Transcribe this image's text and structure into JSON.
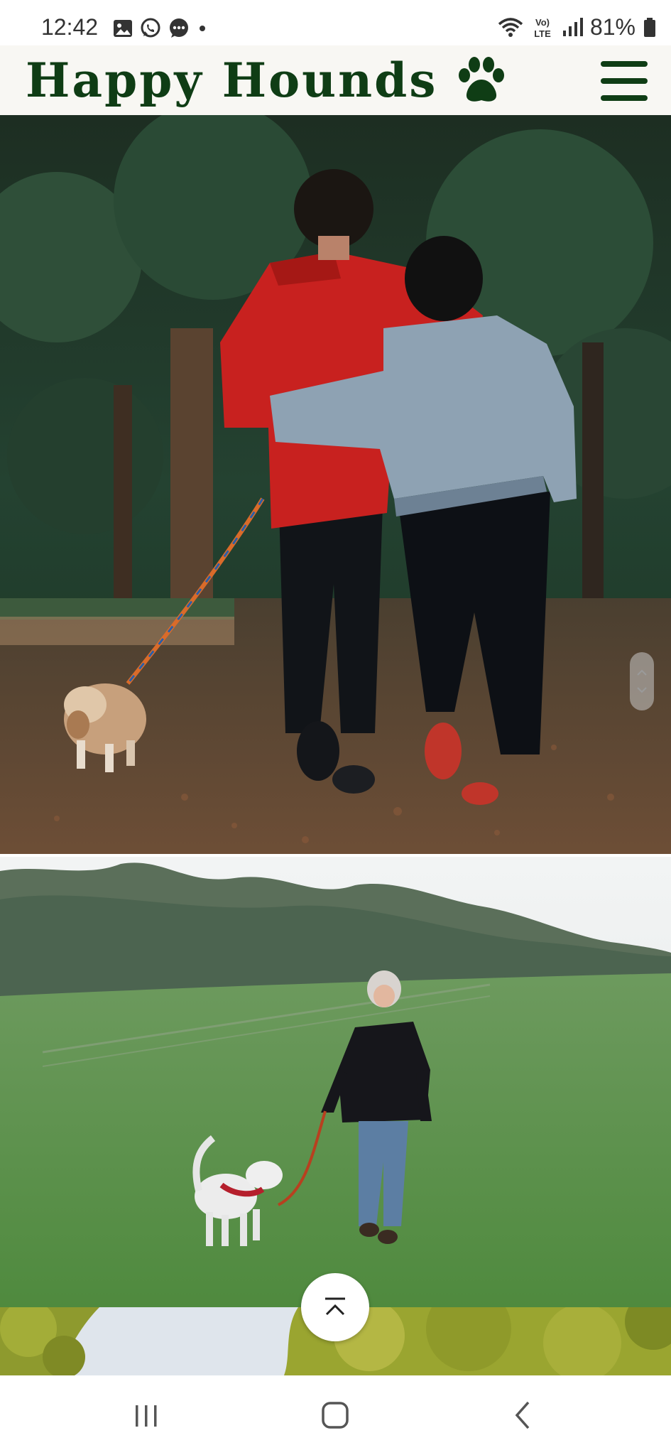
{
  "status_bar": {
    "time": "12:42",
    "left_icons": [
      "gallery-icon",
      "whatsapp-icon",
      "messages-icon",
      "notification-dot-icon"
    ],
    "right_icons": [
      "wifi-icon",
      "volte-icon",
      "signal-icon",
      "battery-icon"
    ],
    "network_label_top": "Vo)",
    "network_label_bottom": "LTE",
    "battery": "81%"
  },
  "header": {
    "title": "Happy Hounds",
    "logo_icon": "paw-icon",
    "menu_icon": "hamburger-menu-icon",
    "brand_color": "#0f3d15",
    "background": "#f8f7f3"
  },
  "photos": [
    {
      "subject": "couple-walking-dog-in-park"
    },
    {
      "subject": "woman-walking-dog-on-field"
    },
    {
      "subject": "trees-and-sky"
    }
  ],
  "controls": {
    "back_to_top_icon": "chevron-up-icon"
  },
  "nav_bar": {
    "items": [
      "recents-icon",
      "home-icon",
      "back-icon"
    ]
  }
}
